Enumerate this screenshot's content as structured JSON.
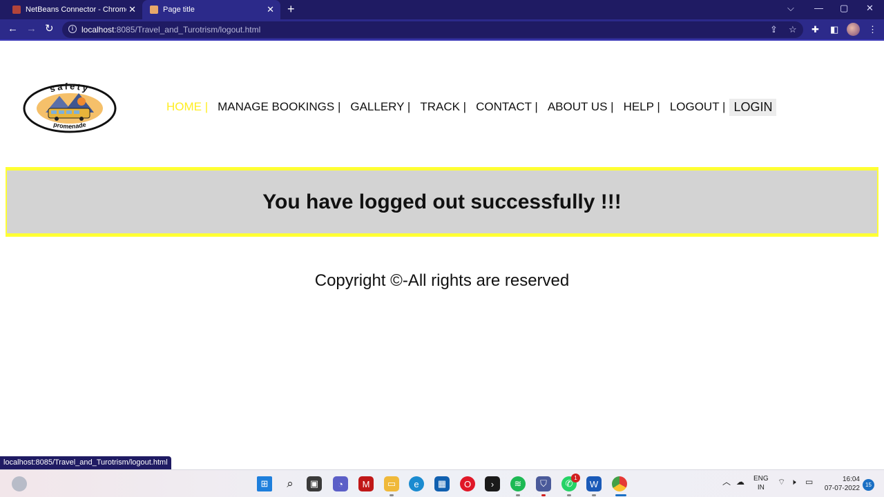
{
  "browser": {
    "tabs": [
      {
        "label": "NetBeans Connector - Chrome W"
      },
      {
        "label": "Page title"
      }
    ],
    "url_host": "localhost",
    "url_path": ":8085/Travel_and_Turotrism/logout.html",
    "status_url": "localhost:8085/Travel_and_Turotrism/logout.html"
  },
  "logo": {
    "top_text": "safety",
    "bottom_text": "promenade"
  },
  "nav": {
    "home": "HOME |",
    "manage_bookings": "MANAGE BOOKINGS |",
    "gallery": "GALLERY |",
    "track": "TRACK |",
    "contact": "CONTACT |",
    "about_us": "ABOUT US |",
    "help": "HELP |",
    "logout": "LOGOUT |",
    "login": "LOGIN"
  },
  "banner": {
    "message": "You have logged out successfully !!!"
  },
  "footer": {
    "copyright": "Copyright ©-All rights are reserved"
  },
  "taskbar": {
    "language_line1": "ENG",
    "language_line2": "IN",
    "time": "16:04",
    "date": "07-07-2022",
    "notification_count": "15",
    "whatsapp_badge": "1"
  },
  "colors": {
    "tabbar": "#1f1b63",
    "toolbar": "#2c2a8a",
    "active_nav": "#ffee22",
    "banner_border": "#ffff33",
    "banner_bg": "#d3d3d3"
  }
}
